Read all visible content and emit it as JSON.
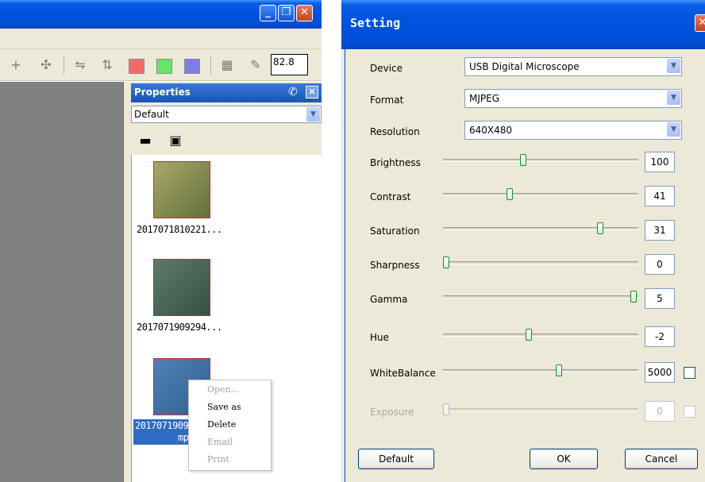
{
  "main_window": {
    "caption_buttons": {
      "minimize": "_",
      "maximize": "❐",
      "close": "✕"
    },
    "zoom_value": "82.8",
    "swatch_colors": [
      "#f26b6b",
      "#6be36b",
      "#7d7de8"
    ],
    "properties_panel": {
      "title": "Properties",
      "mode": "Default",
      "thumbnails": [
        {
          "label": "2017071810221...",
          "colors": [
            "#a8a869",
            "#64703a"
          ]
        },
        {
          "label": "2017071909294...",
          "colors": [
            "#5d7b6c",
            "#375045"
          ]
        },
        {
          "label_line1": "2017071909",
          "label_line2": "mp",
          "colors": [
            "#4f82b5",
            "#2f5f8e"
          ]
        }
      ]
    },
    "context_menu": {
      "items": [
        {
          "label": "Open...",
          "enabled": false
        },
        {
          "label": "Save as",
          "enabled": true
        },
        {
          "label": "Delete",
          "enabled": true
        },
        {
          "label": "Email",
          "enabled": false
        },
        {
          "label": "Print",
          "enabled": false
        }
      ]
    }
  },
  "settings_dialog": {
    "title": "Setting",
    "device": {
      "label": "Device",
      "value": "USB Digital Microscope"
    },
    "format": {
      "label": "Format",
      "value": "MJPEG"
    },
    "resolution": {
      "label": "Resolution",
      "value": "640X480"
    },
    "sliders": [
      {
        "label": "Brightness",
        "value": "100",
        "position": 0.41,
        "auto": false,
        "enabled": true
      },
      {
        "label": "Contrast",
        "value": "41",
        "position": 0.34,
        "auto": false,
        "enabled": true
      },
      {
        "label": "Saturation",
        "value": "31",
        "position": 0.82,
        "auto": false,
        "enabled": true
      },
      {
        "label": "Sharpness",
        "value": "0",
        "position": 0.0,
        "auto": false,
        "enabled": true
      },
      {
        "label": "Gamma",
        "value": "5",
        "position": 1.0,
        "auto": false,
        "enabled": true
      },
      {
        "label": "Hue",
        "value": "-2",
        "position": 0.44,
        "auto": false,
        "enabled": true
      },
      {
        "label": "WhiteBalance",
        "value": "5000",
        "position": 0.6,
        "auto": false,
        "has_checkbox": true,
        "enabled": true
      },
      {
        "label": "Exposure",
        "value": "0",
        "position": 0.0,
        "auto": false,
        "has_checkbox": true,
        "enabled": false
      }
    ],
    "buttons": {
      "default": "Default",
      "ok": "OK",
      "cancel": "Cancel"
    }
  }
}
